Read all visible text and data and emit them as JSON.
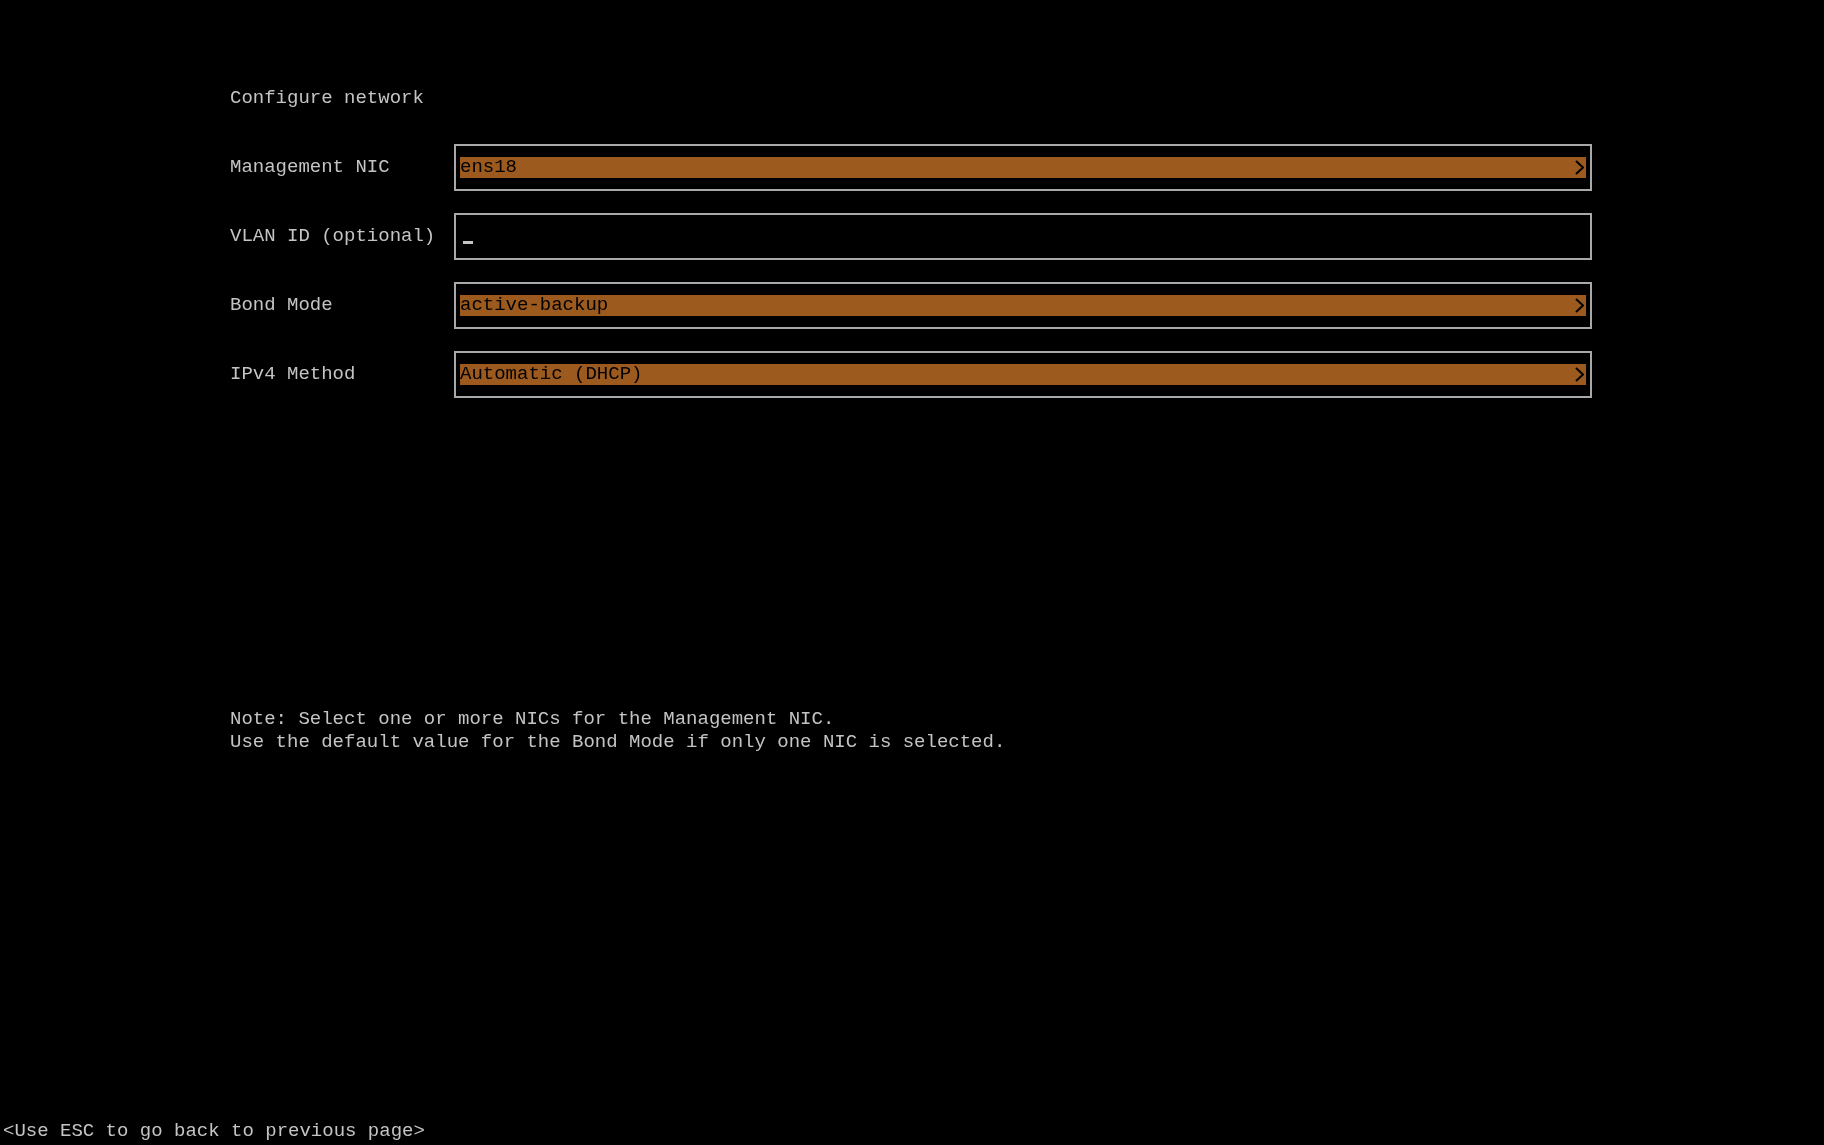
{
  "title": "Configure network",
  "fields": [
    {
      "label": "Management NIC",
      "kind": "select",
      "value": "ens18",
      "focused": false
    },
    {
      "label": "VLAN ID (optional)",
      "kind": "text",
      "focused": true
    },
    {
      "label": "Bond Mode",
      "kind": "select",
      "value": "active-backup",
      "focused": false
    },
    {
      "label": "IPv4 Method",
      "kind": "select",
      "value": "Automatic (DHCP)",
      "focused": false
    }
  ],
  "note": [
    "Note: Select one or more NICs for the Management NIC.",
    "Use the default value for the Bond Mode if only one NIC is selected."
  ],
  "footer": "<Use ESC to go back to previous page>"
}
